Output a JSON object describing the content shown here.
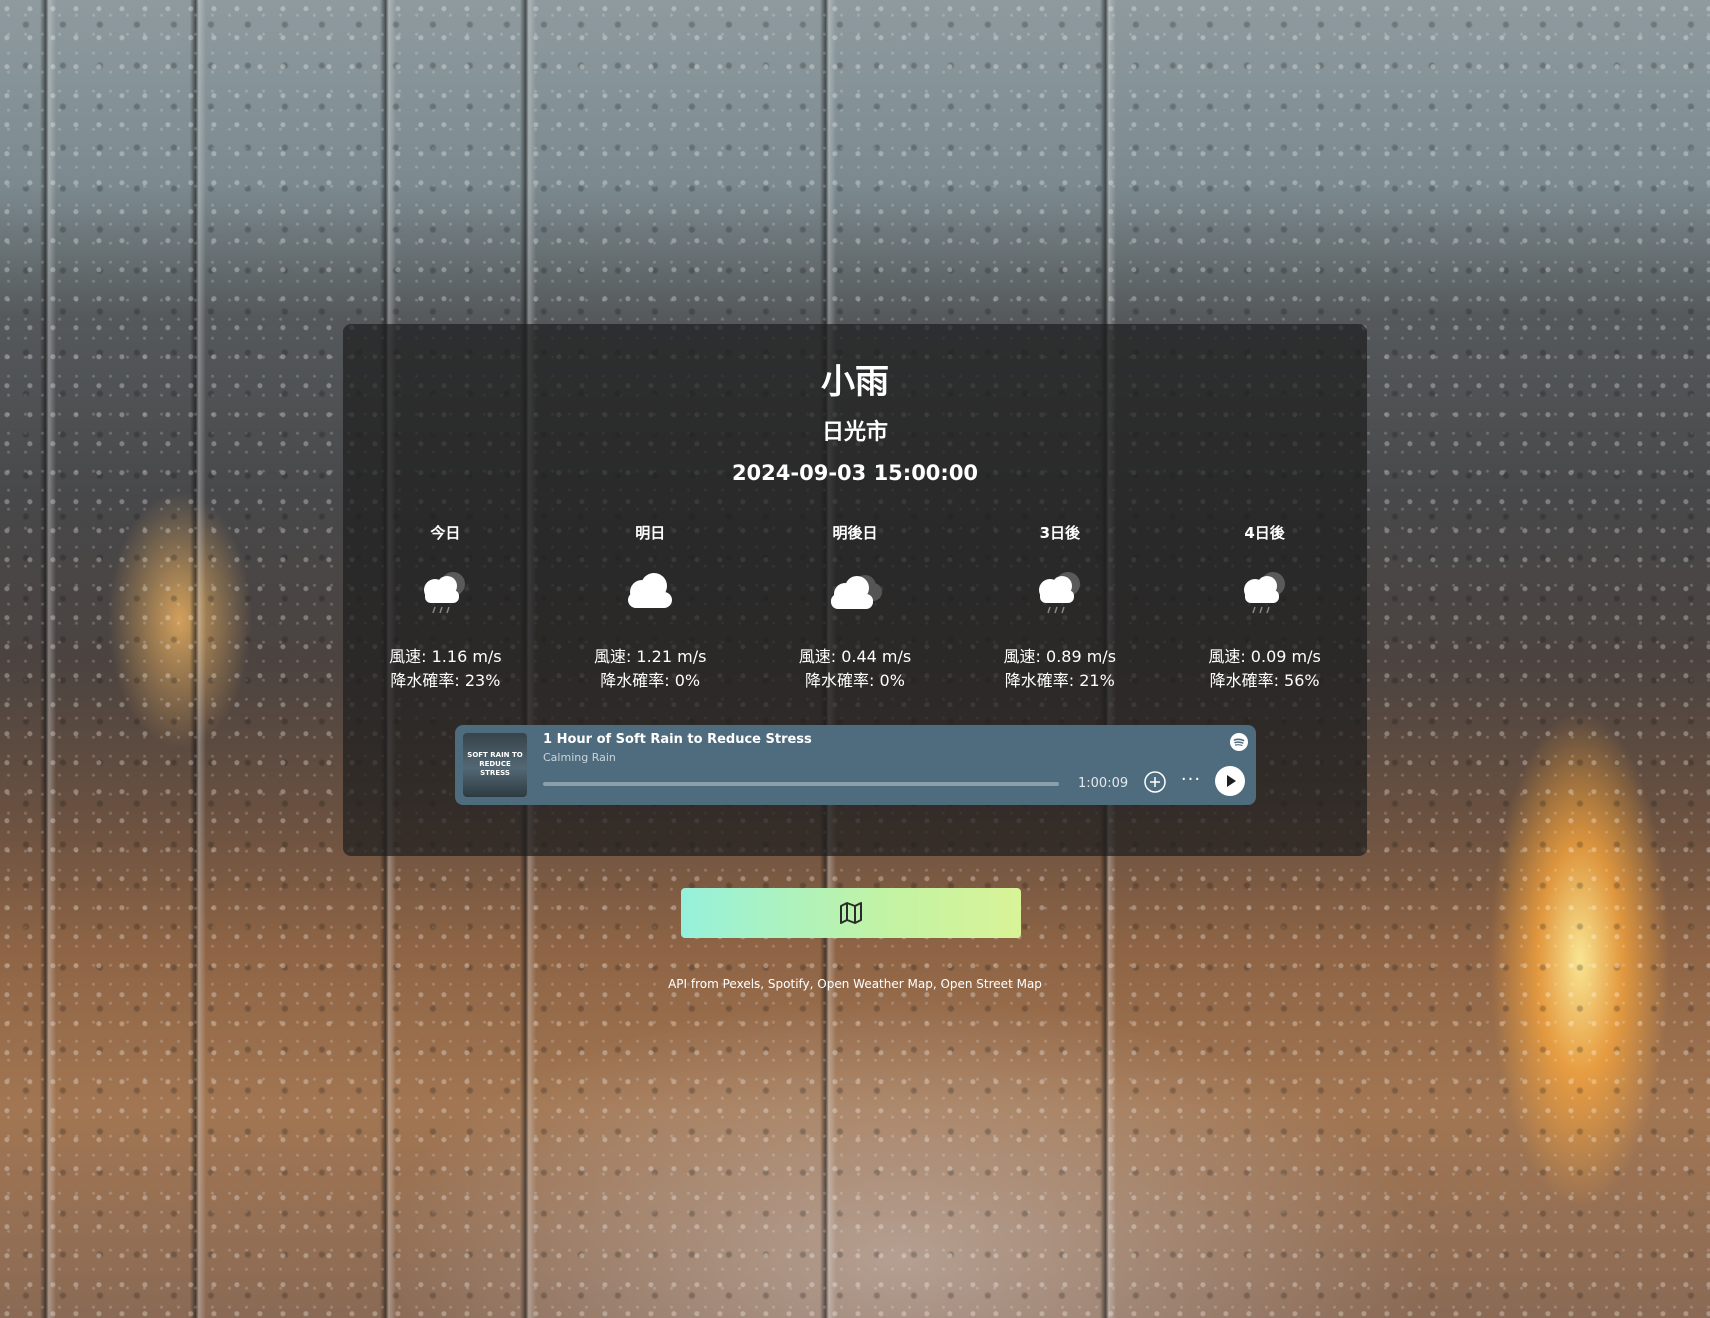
{
  "weather": {
    "condition": "小雨",
    "city": "日光市",
    "datetime": "2024-09-03 15:00:00"
  },
  "forecast": [
    {
      "label": "今日",
      "wind": "風速: 1.16 m/s",
      "precip": "降水確率: 23%",
      "icon": "rain-cloud-icon"
    },
    {
      "label": "明日",
      "wind": "風速: 1.21 m/s",
      "precip": "降水確率: 0%",
      "icon": "cloud-icon"
    },
    {
      "label": "明後日",
      "wind": "風速: 0.44 m/s",
      "precip": "降水確率: 0%",
      "icon": "broken-clouds-icon"
    },
    {
      "label": "3日後",
      "wind": "風速: 0.89 m/s",
      "precip": "降水確率: 21%",
      "icon": "rain-cloud-icon"
    },
    {
      "label": "4日後",
      "wind": "風速: 0.09 m/s",
      "precip": "降水確率: 56%",
      "icon": "rain-cloud-icon"
    }
  ],
  "player": {
    "title": "1 Hour of Soft Rain to Reduce Stress",
    "artist": "Calming Rain",
    "duration": "1:00:09",
    "progress_percent": 0,
    "cover_text": "SOFT RAIN TO REDUCE STRESS",
    "accent_color": "#4e6c7e"
  },
  "map_button": {
    "icon": "map-icon",
    "gradient": [
      "#96f1db",
      "#d9f397"
    ]
  },
  "credits": "API from Pexels, Spotify, Open Weather Map, Open Street Map"
}
